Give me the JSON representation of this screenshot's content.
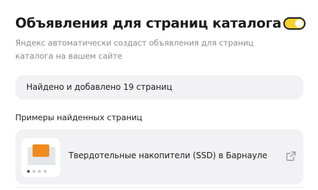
{
  "section": {
    "title": "Объявления для страниц каталога",
    "description": "Яндекс автоматически создаст объявления для страниц каталога на вашем сайте",
    "toggle_on": true
  },
  "found": {
    "text": "Найдено и добавлено 19 страниц"
  },
  "examples": {
    "label": "Примеры найденных страниц",
    "items": [
      {
        "title": "Твердотельные накопители (SSD) в Барнауле",
        "icon": "external-link-icon"
      }
    ]
  },
  "colors": {
    "accent_toggle": "#f7cf2f",
    "panel_bg": "#f2f2f4",
    "muted_text": "#8c8c8c"
  }
}
